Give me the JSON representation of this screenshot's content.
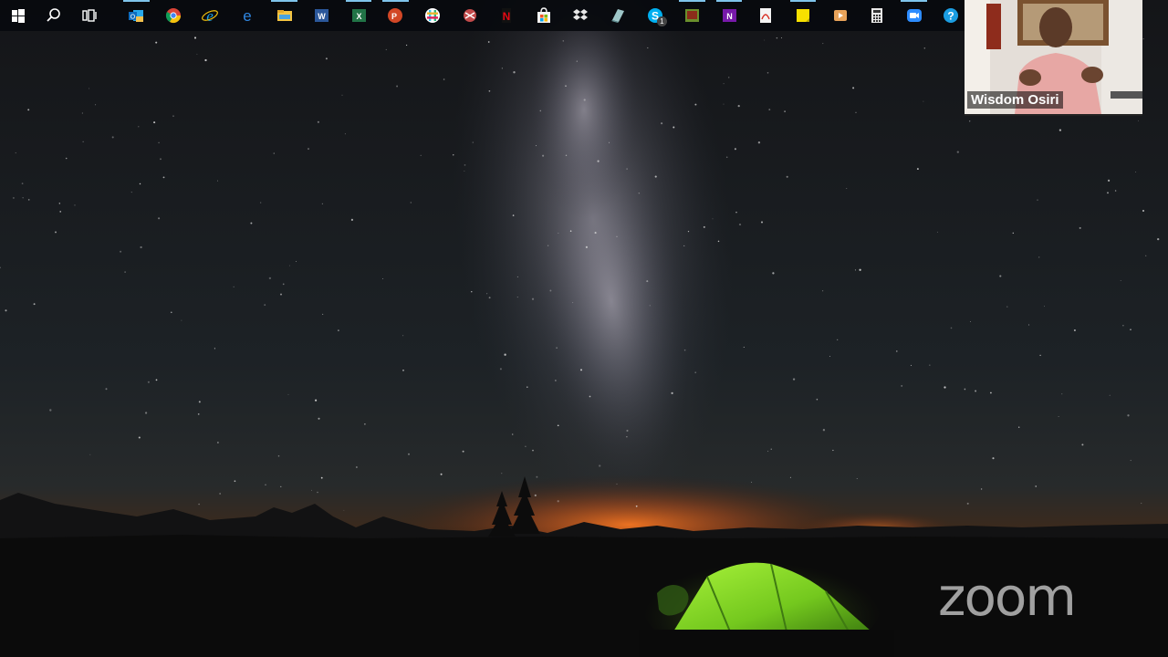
{
  "taskbar": {
    "items": [
      {
        "icon": "windows-start-icon",
        "label": "Start",
        "running": false
      },
      {
        "icon": "search-icon",
        "label": "Search",
        "running": false
      },
      {
        "icon": "task-view-icon",
        "label": "Task View",
        "running": false
      },
      {
        "icon": "outlook-icon",
        "label": "Outlook",
        "running": true,
        "color": "#0f6cbd"
      },
      {
        "icon": "chrome-icon",
        "label": "Google Chrome",
        "running": false
      },
      {
        "icon": "internet-explorer-icon",
        "label": "Internet Explorer",
        "running": false,
        "color": "#1ba1e2"
      },
      {
        "icon": "edge-icon",
        "label": "Microsoft Edge",
        "running": false,
        "color": "#1e7fd8"
      },
      {
        "icon": "file-explorer-icon",
        "label": "File Explorer",
        "running": true,
        "color": "#f5c542"
      },
      {
        "icon": "word-icon",
        "label": "Word",
        "running": false,
        "color": "#2b579a"
      },
      {
        "icon": "excel-icon",
        "label": "Excel",
        "running": true,
        "color": "#217346"
      },
      {
        "icon": "powerpoint-icon",
        "label": "PowerPoint",
        "running": true,
        "color": "#d24726"
      },
      {
        "icon": "slack-icon",
        "label": "Slack",
        "running": false
      },
      {
        "icon": "snipping-tool-icon",
        "label": "Snipping Tool",
        "running": false
      },
      {
        "icon": "netflix-icon",
        "label": "Netflix",
        "running": false,
        "color": "#e50914"
      },
      {
        "icon": "microsoft-store-icon",
        "label": "Microsoft Store",
        "running": false
      },
      {
        "icon": "dropbox-icon",
        "label": "Dropbox",
        "running": false
      },
      {
        "icon": "notes-app-icon",
        "label": "Notes",
        "running": false
      },
      {
        "icon": "skype-icon",
        "label": "Skype",
        "running": false,
        "color": "#00aff0",
        "badge": "1"
      },
      {
        "icon": "photo-viewer-icon",
        "label": "Photo Viewer",
        "running": true
      },
      {
        "icon": "onenote-icon",
        "label": "OneNote",
        "running": true,
        "color": "#7719aa"
      },
      {
        "icon": "pdf-reader-icon",
        "label": "PDF Reader",
        "running": false
      },
      {
        "icon": "sticky-notes-icon",
        "label": "Sticky Notes",
        "running": true,
        "color": "#f7e000"
      },
      {
        "icon": "media-player-icon",
        "label": "Media Player",
        "running": false
      },
      {
        "icon": "calculator-icon",
        "label": "Calculator",
        "running": false
      },
      {
        "icon": "zoom-app-icon",
        "label": "Zoom",
        "running": true,
        "color": "#2d8cff"
      },
      {
        "icon": "help-icon",
        "label": "Get Help",
        "running": false,
        "color": "#1b9de2"
      }
    ]
  },
  "participant": {
    "name": "Wisdom Osiri"
  },
  "watermark": {
    "text": "zoom"
  },
  "colors": {
    "tent": "#7ed321",
    "horizon_glow": "#e8641e",
    "taskbar_indicator": "#7fc4ea",
    "watermark": "#a9a9a9"
  }
}
